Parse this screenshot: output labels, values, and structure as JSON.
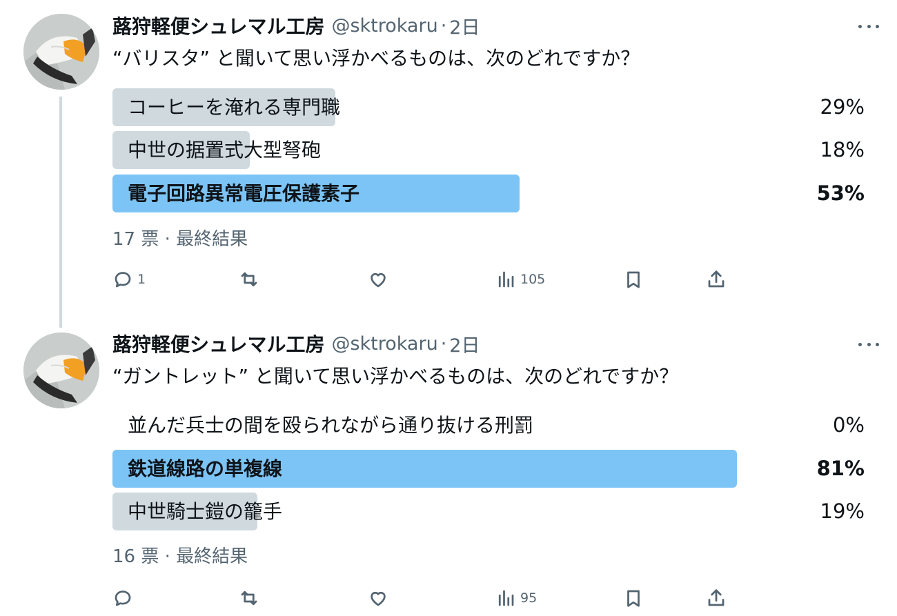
{
  "tweets": [
    {
      "author_name": "蕗狩軽便シュレマル工房",
      "handle": "@sktrokaru",
      "separator": "·",
      "time": "2日",
      "question": "“バリスタ” と聞いて思い浮かべるものは、次のどれですか？",
      "options": [
        {
          "label": "コーヒーを淹れる専門職",
          "percent_text": "29%",
          "percent": 29,
          "winner": false
        },
        {
          "label": "中世の据置式大型弩砲",
          "percent_text": "18%",
          "percent": 18,
          "winner": false
        },
        {
          "label": "電子回路異常電圧保護素子",
          "percent_text": "53%",
          "percent": 53,
          "winner": true
        }
      ],
      "meta": "17 票 · 最終結果",
      "actions": {
        "reply_count": "1",
        "retweet_count": "",
        "like_count": "",
        "view_count": "105"
      }
    },
    {
      "author_name": "蕗狩軽便シュレマル工房",
      "handle": "@sktrokaru",
      "separator": "·",
      "time": "2日",
      "question": "“ガントレット” と聞いて思い浮かべるものは、次のどれですか？",
      "options": [
        {
          "label": "並んだ兵士の間を殴られながら通り抜ける刑罰",
          "percent_text": "0%",
          "percent": 0,
          "winner": false
        },
        {
          "label": "鉄道線路の単複線",
          "percent_text": "81%",
          "percent": 81,
          "winner": true
        },
        {
          "label": "中世騎士鎧の籠手",
          "percent_text": "19%",
          "percent": 19,
          "winner": false
        }
      ],
      "meta": "16 票 · 最終結果",
      "actions": {
        "reply_count": "",
        "retweet_count": "",
        "like_count": "",
        "view_count": "95"
      }
    }
  ],
  "colors": {
    "bar_default": "#cfd9de",
    "bar_winner": "#7cc4f5",
    "secondary_text": "#536471",
    "primary_text": "#0f1419"
  },
  "icons": [
    "reply-icon",
    "retweet-icon",
    "like-icon",
    "views-icon",
    "bookmark-icon",
    "share-icon",
    "more-icon"
  ]
}
